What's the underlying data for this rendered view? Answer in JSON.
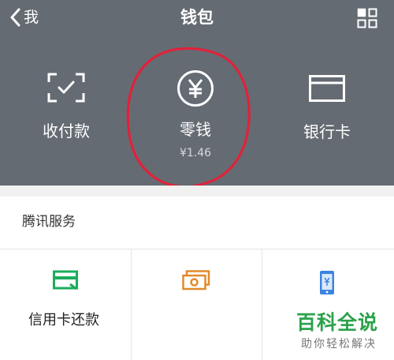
{
  "nav": {
    "back_label": "我",
    "title": "钱包"
  },
  "features": [
    {
      "label": "收付款"
    },
    {
      "label": "零钱",
      "amount": "¥1.46"
    },
    {
      "label": "银行卡"
    }
  ],
  "services_section": {
    "title": "腾讯服务",
    "items": [
      {
        "label": "信用卡还款"
      },
      {
        "label": ""
      },
      {
        "label": ""
      }
    ]
  },
  "watermark": {
    "title": "百科全说",
    "subtitle": "助你轻松解决"
  },
  "colors": {
    "header_bg": "#656b73",
    "annotation_red": "#e0223a",
    "icon_green": "#1aad5b",
    "icon_orange": "#e28a2c",
    "icon_blue": "#3c83e0",
    "watermark_green": "#2aa24a"
  }
}
